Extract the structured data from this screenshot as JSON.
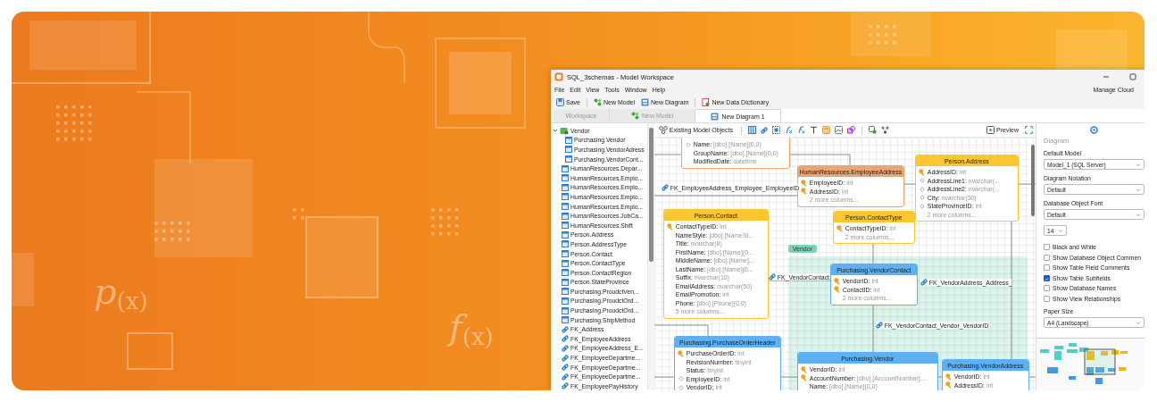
{
  "decor_labels": [
    "p$_{(x)}$",
    "f$_{(x)}$"
  ],
  "window": {
    "title": "SQL_3schemas - Model Workspace"
  },
  "menu": [
    "File",
    "Edit",
    "View",
    "Tools",
    "Window",
    "Help"
  ],
  "manage_cloud": "Manage Cloud",
  "toolbar": [
    {
      "label": "Save",
      "kind": "save"
    },
    {
      "label": "New Model",
      "kind": "model"
    },
    {
      "label": "New Diagram",
      "kind": "diagram"
    },
    {
      "label": "New Data Dictionary",
      "kind": "dictionary"
    }
  ],
  "tabs": [
    {
      "label": "Workspace",
      "kind": "plain",
      "selected": false
    },
    {
      "label": "New Model",
      "kind": "model",
      "selected": false
    },
    {
      "label": "New Diagram 1",
      "kind": "diagram",
      "selected": true
    }
  ],
  "tree": [
    {
      "label": "Vendor",
      "kind": "group",
      "expanded": true,
      "children": [
        {
          "label": "Purchasing.Vendor",
          "kind": "table"
        },
        {
          "label": "Purchasing.VendorAdress",
          "kind": "table"
        },
        {
          "label": "Purchasing.VendorCont...",
          "kind": "table"
        }
      ]
    },
    {
      "label": "HumanResources.Depar...",
      "kind": "table"
    },
    {
      "label": "HumanResources.Emplo...",
      "kind": "table"
    },
    {
      "label": "HumanResources.Emplo...",
      "kind": "table"
    },
    {
      "label": "HumanResources.Emplo...",
      "kind": "table"
    },
    {
      "label": "HumanResources.Emplo...",
      "kind": "table"
    },
    {
      "label": "HumanResources.JobCa...",
      "kind": "table"
    },
    {
      "label": "HumanResources.Shift",
      "kind": "table"
    },
    {
      "label": "Person.Address",
      "kind": "table"
    },
    {
      "label": "Person.AddressType",
      "kind": "table"
    },
    {
      "label": "Person.Contact",
      "kind": "table"
    },
    {
      "label": "Person.ContactType",
      "kind": "table"
    },
    {
      "label": "Person.ContactRegion",
      "kind": "table"
    },
    {
      "label": "Person.StateProvince",
      "kind": "table"
    },
    {
      "label": "Purchasing.ProudctVen...",
      "kind": "table"
    },
    {
      "label": "Purchasing.ProudctOrd...",
      "kind": "table"
    },
    {
      "label": "Purchasing.ProudctOrd...",
      "kind": "table"
    },
    {
      "label": "Purchasing.ShipMethod",
      "kind": "table"
    },
    {
      "label": "FK_Address",
      "kind": "relationship"
    },
    {
      "label": "FK_EmployeeAddress",
      "kind": "relationship"
    },
    {
      "label": "FK_EmployeeAddress_E...",
      "kind": "relationship"
    },
    {
      "label": "FK_EmployeeDepartme...",
      "kind": "relationship"
    },
    {
      "label": "FK_EmployeeDepartme...",
      "kind": "relationship"
    },
    {
      "label": "FK_EmployeeDepartme...",
      "kind": "relationship"
    },
    {
      "label": "FK_EmployeePayHistory",
      "kind": "relationship"
    }
  ],
  "diagram_toolbar": {
    "existing": "Existing Model Objects",
    "preview": "Preview"
  },
  "diagram": {
    "entities": [
      {
        "color": "#efa56e",
        "columns": [
          {
            "name": "Name:",
            "type": "[dbo].[Name](0,0)",
            "kind": "attribute"
          },
          {
            "name": "GroupName:",
            "type": "[dbo].[Name](0,0)",
            "kind": "plain"
          },
          {
            "name": "ModifiedDate:",
            "type": "datetime",
            "kind": "plain"
          }
        ]
      },
      {
        "title": "HumanResources.EmployeeAddress",
        "color": "#eba574",
        "columns": [
          {
            "name": "EmployeeID:",
            "type": "int",
            "kind": "key"
          },
          {
            "name": "AddressID:",
            "type": "int",
            "kind": "key"
          }
        ],
        "more": "2 more columns..."
      },
      {
        "title": "Person.Address",
        "color": "#fcc633",
        "columns": [
          {
            "name": "AddressID:",
            "type": "int",
            "kind": "key"
          },
          {
            "name": "AddressLine1:",
            "type": "nvarchar(...",
            "kind": "attribute"
          },
          {
            "name": "AddressLine2:",
            "type": "nvarchar(...",
            "kind": "attribute"
          },
          {
            "name": "City:",
            "type": "nvarchar(30)",
            "kind": "attribute"
          },
          {
            "name": "StateProvinceID:",
            "type": "int",
            "kind": "attribute"
          }
        ],
        "more": "2 more columns..."
      },
      {
        "title": "Person.Contact",
        "color": "#fcc633",
        "columns": [
          {
            "name": "ContactTypeID:",
            "type": "int",
            "kind": "key"
          },
          {
            "name": "NameStyle:",
            "type": "[dbo].[NameSt...",
            "kind": "plain"
          },
          {
            "name": "Title:",
            "type": "nvarchar(8)",
            "kind": "plain"
          },
          {
            "name": "FirstName:",
            "type": "[dbo].[Name](0...",
            "kind": "plain"
          },
          {
            "name": "MiddleName:",
            "type": "[dbo].[Name]...",
            "kind": "plain"
          },
          {
            "name": "LastName:",
            "type": "[dbo].[Name](0...",
            "kind": "plain"
          },
          {
            "name": "Suffix:",
            "type": "nvarchar(10)",
            "kind": "plain"
          },
          {
            "name": "EmailAddress:",
            "type": "nvarchar(50)",
            "kind": "plain"
          },
          {
            "name": "EmailPromotion:",
            "type": "int",
            "kind": "plain"
          },
          {
            "name": "Phone:",
            "type": "[dbo].[Phone](0,0)",
            "kind": "plain"
          }
        ],
        "more": "5 more columns..."
      },
      {
        "title": "Person.ContactType",
        "color": "#fcc633",
        "columns": [
          {
            "name": "ContactTypeID:",
            "type": "int",
            "kind": "key"
          }
        ],
        "more": "2 more columns..."
      },
      {
        "title": "Purchasing.VendorContact",
        "color": "#5eb0f2",
        "columns": [
          {
            "name": "VendorID:",
            "type": "int",
            "kind": "key"
          },
          {
            "name": "ContactID:",
            "type": "int",
            "kind": "key"
          }
        ],
        "more": "2 more columns..."
      },
      {
        "title": "Purchasing.PurchaseOrderHeader",
        "color": "#5eb0f2",
        "columns": [
          {
            "name": "PurchaseOrderID:",
            "type": "int",
            "kind": "key"
          },
          {
            "name": "RevisionNumber:",
            "type": "tinyint",
            "kind": "plain"
          },
          {
            "name": "Status:",
            "type": "tinyint",
            "kind": "plain"
          },
          {
            "name": "EmployeeID:",
            "type": "int",
            "kind": "attribute"
          },
          {
            "name": "VendorID:",
            "type": "int",
            "kind": "attribute"
          }
        ]
      },
      {
        "title": "Purchasing.Vendor",
        "color": "#5eb0f2",
        "columns": [
          {
            "name": "VendorID:",
            "type": "int",
            "kind": "key"
          },
          {
            "name": "AccountNumber:",
            "type": "[dbo].[AccountNumber]...",
            "kind": "key"
          },
          {
            "name": "Name:",
            "type": "[dbo].[Name](0,0)",
            "kind": "plain"
          }
        ]
      },
      {
        "title": "Purchasing.VendorAddress",
        "color": "#5eb0f2",
        "columns": [
          {
            "name": "VendorID:",
            "type": "int",
            "kind": "key"
          },
          {
            "name": "AddressID:",
            "type": "int",
            "kind": "key"
          }
        ]
      }
    ],
    "groups": [
      {
        "label": "Vendor"
      }
    ],
    "relationships": [
      {
        "label": "FK_EmployeeAddress_Employee_EmployeeID"
      },
      {
        "label": "FK_VendorContact"
      },
      {
        "label": "FK_VendorContact_Vendor_VendorID"
      },
      {
        "label": "FK_VendorAddress_Address_"
      }
    ]
  },
  "panel": {
    "heading": "Diagram",
    "fields": [
      {
        "label": "Default Model",
        "value": "Model_1 (SQL Server)"
      },
      {
        "label": "Diagram Notation",
        "value": "Default"
      },
      {
        "label": "Database Object Font",
        "value": "Default"
      }
    ],
    "font_size": "14",
    "options": [
      {
        "label": "Black and White",
        "checked": false
      },
      {
        "label": "Show Database Object Commen",
        "checked": false
      },
      {
        "label": "Show Table Field Comments",
        "checked": false
      },
      {
        "label": "Show Table Subfields",
        "checked": true
      },
      {
        "label": "Show Database Names",
        "checked": false
      },
      {
        "label": "Show View Relationships",
        "checked": false
      }
    ],
    "paper_size": {
      "label": "Paper Size",
      "value": "A4 (Landscape)"
    }
  }
}
